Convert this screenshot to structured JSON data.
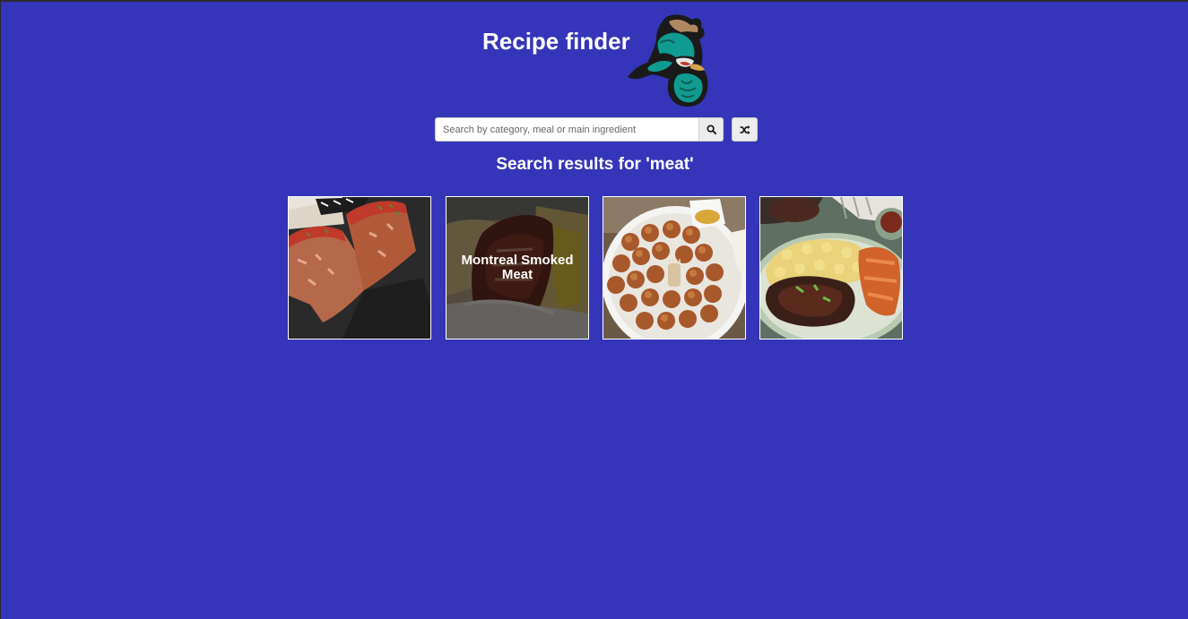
{
  "app": {
    "title": "Recipe finder",
    "logo_icon": "rooster-mascot-icon"
  },
  "search": {
    "placeholder": "Search by category, meal or main ingredient",
    "value": "",
    "search_icon": "search-icon",
    "random_icon": "shuffle-icon"
  },
  "results": {
    "heading": "Search results for 'meat'",
    "meals": [
      {
        "name": "",
        "hovered": false
      },
      {
        "name": "Montreal Smoked Meat",
        "hovered": true
      },
      {
        "name": "",
        "hovered": false
      },
      {
        "name": "",
        "hovered": false
      }
    ]
  },
  "colors": {
    "background": "#3535b9",
    "text": "#ffffff"
  }
}
